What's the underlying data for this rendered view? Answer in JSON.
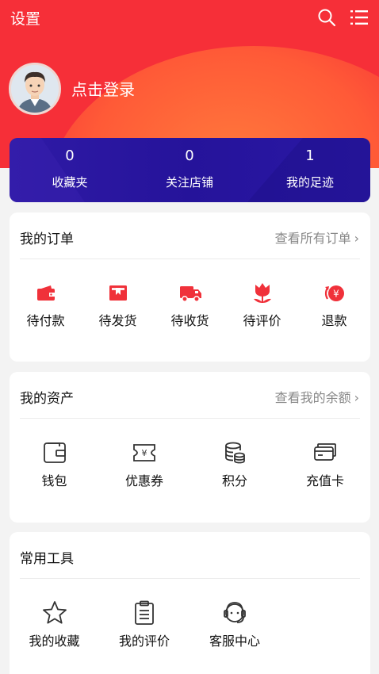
{
  "header": {
    "settings_label": "设置",
    "login_label": "点击登录"
  },
  "stats": [
    {
      "value": "0",
      "label": "收藏夹"
    },
    {
      "value": "0",
      "label": "关注店铺"
    },
    {
      "value": "1",
      "label": "我的足迹"
    }
  ],
  "orders": {
    "title": "我的订单",
    "link": "查看所有订单",
    "items": [
      {
        "label": "待付款",
        "icon": "wallet-icon"
      },
      {
        "label": "待发货",
        "icon": "box-icon"
      },
      {
        "label": "待收货",
        "icon": "truck-icon"
      },
      {
        "label": "待评价",
        "icon": "flower-icon"
      },
      {
        "label": "退款",
        "icon": "refund-icon"
      }
    ]
  },
  "assets": {
    "title": "我的资产",
    "link": "查看我的余额",
    "items": [
      {
        "label": "钱包",
        "icon": "wallet-outline-icon"
      },
      {
        "label": "优惠券",
        "icon": "coupon-icon"
      },
      {
        "label": "积分",
        "icon": "coins-icon"
      },
      {
        "label": "充值卡",
        "icon": "card-icon"
      }
    ]
  },
  "tools": {
    "title": "常用工具",
    "items": [
      {
        "label": "我的收藏",
        "icon": "star-icon"
      },
      {
        "label": "我的评价",
        "icon": "clipboard-icon"
      },
      {
        "label": "客服中心",
        "icon": "headset-icon"
      }
    ]
  },
  "colors": {
    "brand_red": "#f62f38",
    "stats_purple": "#26149c",
    "icon_red": "#f0313a"
  }
}
